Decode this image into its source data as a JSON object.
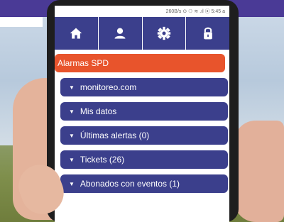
{
  "status_bar": {
    "text": "260B/s ⊙ ⚆ ≋ .ıl ⦿ 5:45 a"
  },
  "nav": {
    "items": [
      {
        "icon": "home-icon"
      },
      {
        "icon": "user-icon"
      },
      {
        "icon": "gear-icon"
      },
      {
        "icon": "lock-icon"
      }
    ]
  },
  "menu": {
    "header": "Alarmas SPD",
    "items": [
      {
        "label": "monitoreo.com"
      },
      {
        "label": "Mis datos"
      },
      {
        "label": "Últimas alertas (0)"
      },
      {
        "label": "Tickets (26)"
      },
      {
        "label": "Abonados con eventos (1)"
      }
    ]
  },
  "colors": {
    "nav_bg": "#3b3f8c",
    "alarm_bg": "#e8542c",
    "banner": "#4a3a96"
  }
}
